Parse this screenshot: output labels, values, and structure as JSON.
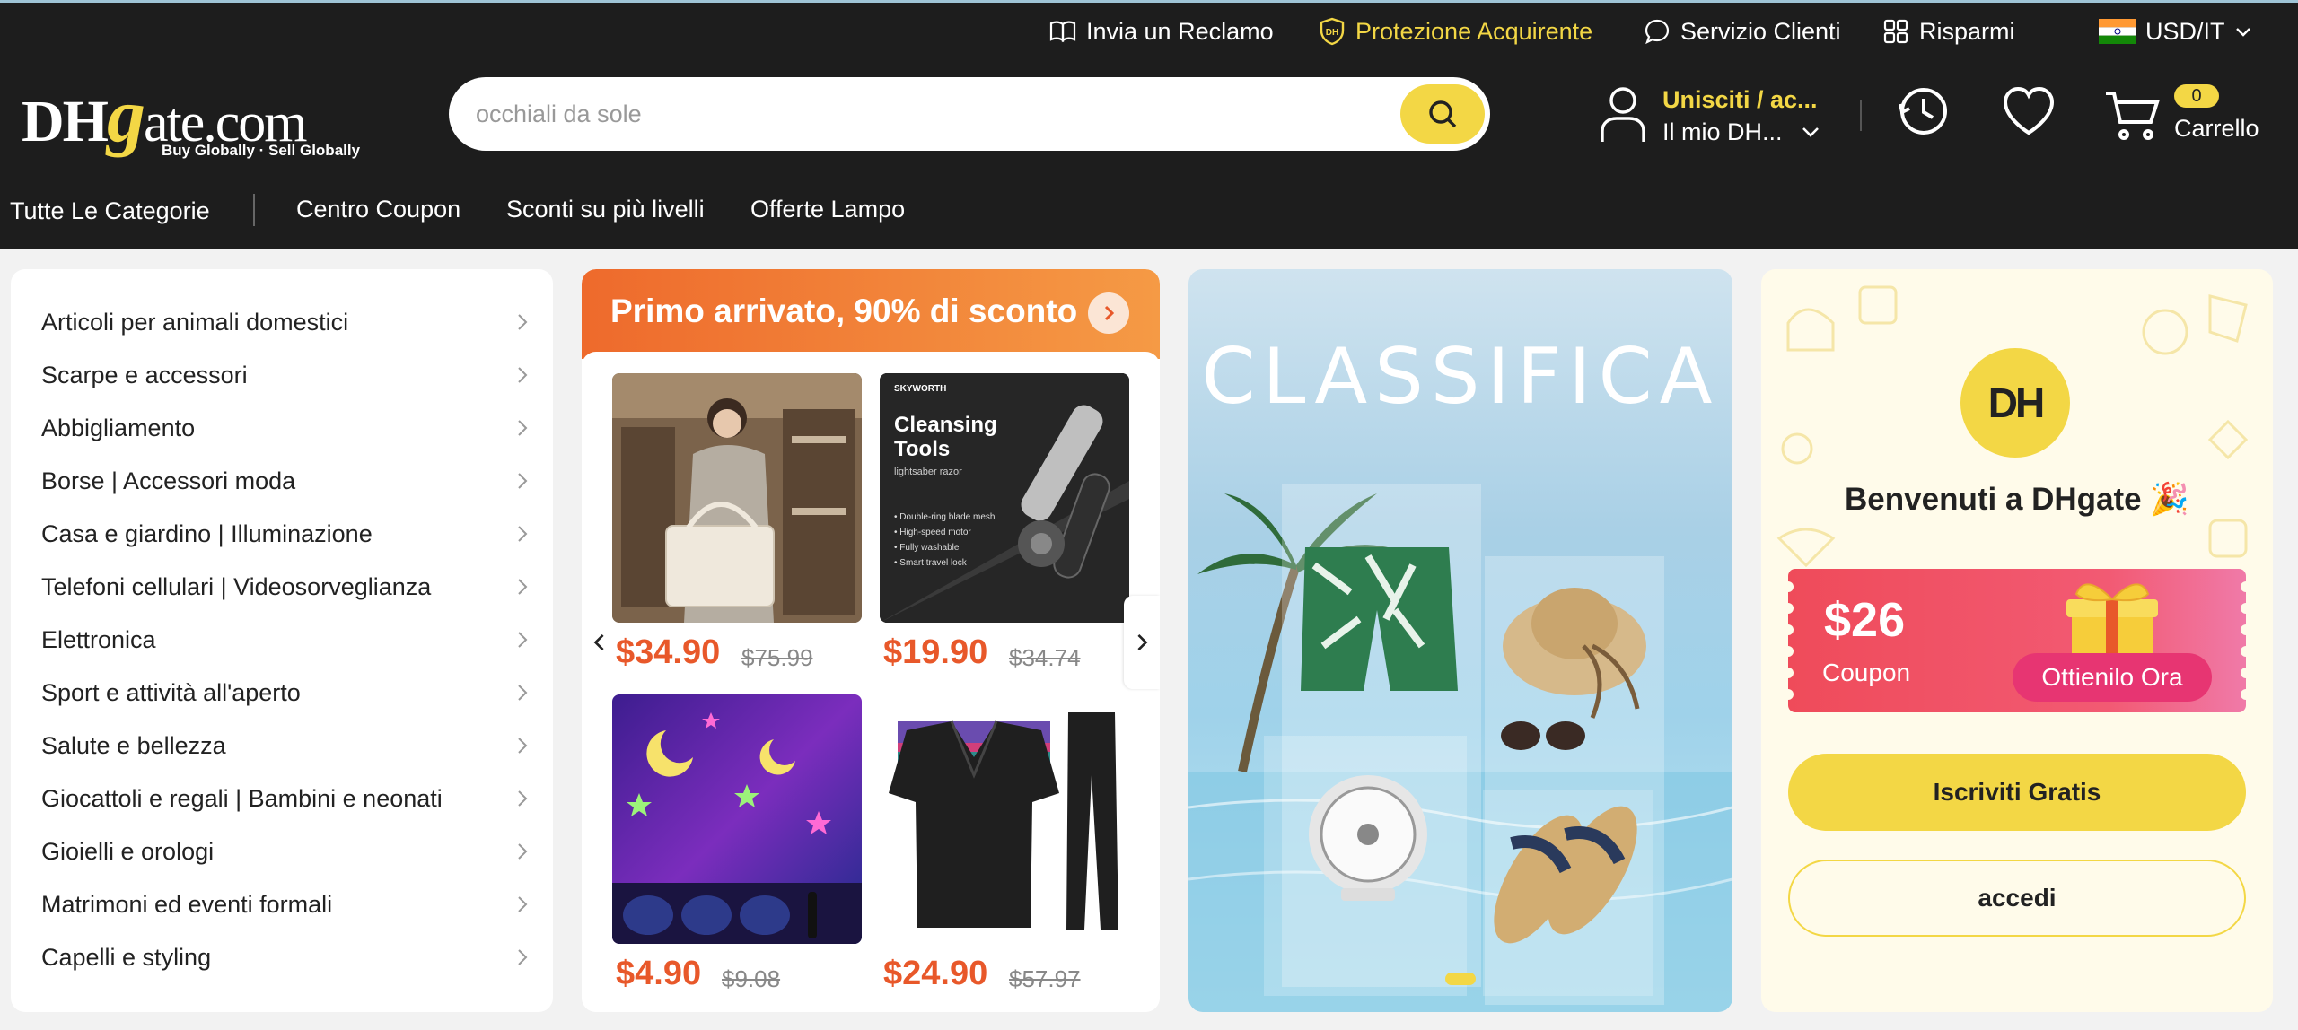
{
  "topbar": {
    "complaint": "Invia un Reclamo",
    "buyer_protection": "Protezione Acquirente",
    "customer_service": "Servizio Clienti",
    "savings": "Risparmi",
    "currency": "USD/IT"
  },
  "header": {
    "logo_main_pre": "DH",
    "logo_main_g": "g",
    "logo_main_post": "ate.com",
    "logo_tagline": "Buy Globally · Sell Globally",
    "search_placeholder": "occhiali da sole",
    "account_line1": "Unisciti / ac...",
    "account_line2": "Il mio DH...",
    "cart_count": "0",
    "cart_label": "Carrello"
  },
  "catnav": {
    "all_categories": "Tutte Le Categorie",
    "items": [
      "Centro Coupon",
      "Sconti su più livelli",
      "Offerte Lampo"
    ]
  },
  "categories": [
    "Articoli per animali domestici",
    "Scarpe e accessori",
    "Abbigliamento",
    "Borse | Accessori moda",
    "Casa e giardino | Illuminazione",
    "Telefoni cellulari | Videosorveglianza",
    "Elettronica",
    "Sport e attività all'aperto",
    "Salute e bellezza",
    "Giocattoli e regali | Bambini e neonati",
    "Gioielli e orologi",
    "Matrimoni ed eventi formali",
    "Capelli e styling"
  ],
  "flash": {
    "title": "Primo arrivato, 90% di sconto",
    "products": [
      {
        "price": "$34.90",
        "old_price": "$75.99"
      },
      {
        "price": "$19.90",
        "old_price": "$34.74",
        "image_brand": "SKYWORTH",
        "image_title": "Cleansing Tools",
        "image_subtitle": "lightsaber razor",
        "image_bullets": [
          "Double-ring blade mesh",
          "High-speed motor",
          "Fully washable",
          "Smart travel lock"
        ]
      },
      {
        "price": "$4.90",
        "old_price": "$9.08"
      },
      {
        "price": "$24.90",
        "old_price": "$57.97"
      }
    ]
  },
  "banner": {
    "title": "CLASSIFICA"
  },
  "welcome": {
    "avatar": "DH",
    "title": "Benvenuti a DHgate 🎉",
    "coupon_amount": "$26",
    "coupon_label": "Coupon",
    "coupon_button": "Ottienilo Ora",
    "join_button": "Iscriviti Gratis",
    "login_button": "accedi"
  },
  "colors": {
    "brand_yellow": "#f3d745",
    "header_bg": "#1d1d1d",
    "price_orange": "#e8582a",
    "coupon_red": "#ef4b5a"
  }
}
